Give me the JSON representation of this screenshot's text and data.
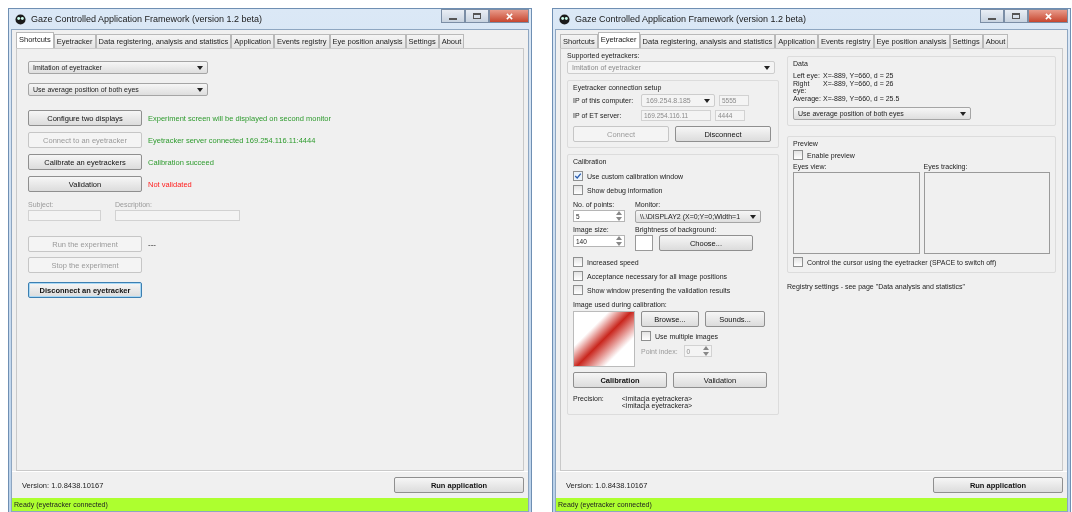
{
  "windows": [
    {
      "kind": "shortcuts",
      "title": "Gaze Controlled Application Framework (version 1.2 beta)",
      "tabs": [
        {
          "label": "Shortcuts",
          "selected": true
        },
        {
          "label": "Eyetracker",
          "selected": false
        },
        {
          "label": "Data registering, analysis and statistics",
          "selected": false
        },
        {
          "label": "Application",
          "selected": false
        },
        {
          "label": "Events registry",
          "selected": false
        },
        {
          "label": "Eye position analysis",
          "selected": false
        },
        {
          "label": "Settings",
          "selected": false
        },
        {
          "label": "About",
          "selected": false
        }
      ],
      "dropdowns": [
        "Imitation of eyetracker",
        "Use average position of both eyes"
      ],
      "actions": [
        {
          "button": "Configure two displays",
          "disabled": false,
          "status": "Experiment screen will be displayed on second monitor",
          "kind": "success"
        },
        {
          "button": "Connect to an eyetracker",
          "disabled": true,
          "status": "Eyetracker server connected 169.254.116.11:4444",
          "kind": "success"
        },
        {
          "button": "Calibrate an eyetrackers",
          "disabled": false,
          "status": "Calibration succeed",
          "kind": "success"
        },
        {
          "button": "Validation",
          "disabled": false,
          "status": "Not validated",
          "kind": "error"
        }
      ],
      "fields": [
        {
          "label": "Subject:",
          "disabled": true
        },
        {
          "label": "Description:",
          "disabled": true
        }
      ],
      "experiment": [
        {
          "button": "Run the experiment",
          "disabled": true,
          "status": "---"
        },
        {
          "button": "Stop the experiment",
          "disabled": true
        }
      ],
      "disconnect": {
        "label": "Disconnect an eyetracker",
        "focused": true
      },
      "version": "Version: 1.0.8438.10167",
      "run_button": "Run application",
      "status": "Ready (eyetracker connected)"
    },
    {
      "kind": "eyetracker",
      "title": "Gaze Controlled Application Framework (version 1.2 beta)",
      "tabs": [
        {
          "label": "Shortcuts",
          "selected": false
        },
        {
          "label": "Eyetracker",
          "selected": true
        },
        {
          "label": "Data registering, analysis and statistics",
          "selected": false
        },
        {
          "label": "Application",
          "selected": false
        },
        {
          "label": "Events registry",
          "selected": false
        },
        {
          "label": "Eye position analysis",
          "selected": false
        },
        {
          "label": "Settings",
          "selected": false
        },
        {
          "label": "About",
          "selected": false
        }
      ],
      "supported": {
        "label": "Supported eyetrackers:",
        "value": "Imitation of eyetracker",
        "disabled": true
      },
      "connection": {
        "title": "Eyetracker connection setup",
        "rows": [
          {
            "kind": "dropdown",
            "label": "IP of this computer:",
            "ip": "169.254.8.185",
            "port": "5555"
          },
          {
            "kind": "text",
            "label": "IP of ET server:",
            "ip": "169.254.116.11",
            "port": "4444"
          }
        ],
        "buttons": [
          {
            "label": "Connect",
            "disabled": true
          },
          {
            "label": "Disconnect",
            "disabled": false
          }
        ]
      },
      "calibration": {
        "title": "Calibration",
        "options": [
          {
            "label": "Use custom calibration window",
            "checked": true
          },
          {
            "label": "Show debug information",
            "checked": false
          }
        ],
        "points": {
          "label": "No. of points:",
          "value": "5"
        },
        "monitor": {
          "label": "Monitor:",
          "value": "\\\\.\\DISPLAY2 (X=0;Y=0;Width=1"
        },
        "image_size": {
          "label": "Image size:",
          "value": "140"
        },
        "brightness": {
          "label": "Brightness of background:",
          "color": "#ffffff",
          "button": "Choose..."
        },
        "more_options": [
          {
            "label": "Increased speed",
            "checked": false
          },
          {
            "label": "Acceptance necessary for all image positions",
            "checked": false
          },
          {
            "label": "Show window presenting the validation results",
            "checked": false
          }
        ],
        "image_label": "Image used during calibration:",
        "browse": "Browse...",
        "sounds": "Sounds...",
        "multiple": {
          "label": "Use multiple images",
          "checked": false
        },
        "point_index": {
          "label": "Point index:",
          "value": "0",
          "disabled": true
        },
        "buttons": [
          {
            "label": "Calibration",
            "default": true
          },
          {
            "label": "Validation",
            "default": false
          }
        ],
        "precision": {
          "label": "Precision:",
          "lines": [
            "<imitacja eyetrackera>",
            "<imitacja eyetrackera>"
          ]
        }
      },
      "data": {
        "title": "Data",
        "rows": [
          {
            "label": "Left eye:",
            "value": "X=-889, Y=660, d = 25"
          },
          {
            "label": "Right eye:",
            "value": "X=-889, Y=660, d = 26"
          },
          {
            "label": "Average:",
            "value": "X=-889, Y=660, d = 25.5"
          }
        ],
        "dropdown": "Use average position of both eyes"
      },
      "preview": {
        "title": "Preview",
        "enable": {
          "label": "Enable preview",
          "checked": false
        },
        "panes": [
          "Eyes view:",
          "Eyes tracking:"
        ],
        "cursor": {
          "label": "Control the cursor using the eyetracker (SPACE to switch off)",
          "checked": false
        }
      },
      "registry_note": "Registry settings - see page \"Data analysis and statistics\"",
      "version": "Version: 1.0.8438.10167",
      "run_button": "Run application",
      "status": "Ready (eyetracker connected)"
    }
  ]
}
